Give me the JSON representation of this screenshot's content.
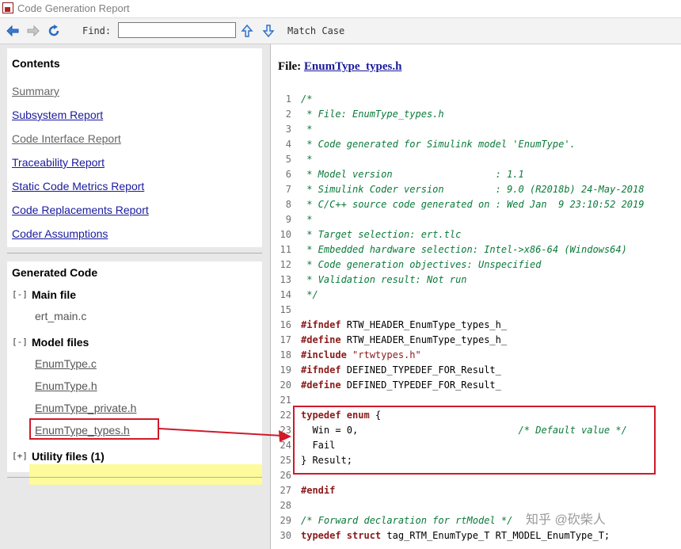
{
  "window": {
    "title": "Code Generation Report"
  },
  "toolbar": {
    "back_icon": "back-arrow-icon",
    "forward_icon": "forward-arrow-icon",
    "refresh_icon": "refresh-icon",
    "find_label": "Find:",
    "find_value": "",
    "find_up_icon": "find-up-icon",
    "find_down_icon": "find-down-icon",
    "match_case_label": "Match Case"
  },
  "contents": {
    "title": "Contents",
    "links": [
      {
        "label": "Summary",
        "style": "gray"
      },
      {
        "label": "Subsystem Report",
        "style": "blue"
      },
      {
        "label": "Code Interface Report",
        "style": "gray"
      },
      {
        "label": "Traceability Report",
        "style": "blue"
      },
      {
        "label": "Static Code Metrics Report",
        "style": "blue"
      },
      {
        "label": "Code Replacements Report",
        "style": "blue"
      },
      {
        "label": "Coder Assumptions",
        "style": "blue"
      }
    ]
  },
  "generated_code": {
    "title": "Generated Code",
    "main_file": {
      "toggle": "[-]",
      "label": "Main file",
      "files": [
        "ert_main.c"
      ]
    },
    "model_files": {
      "toggle": "[-]",
      "label": "Model files",
      "files": [
        "EnumType.c",
        "EnumType.h",
        "EnumType_private.h",
        "EnumType_types.h"
      ]
    },
    "utility_files": {
      "toggle": "[+]",
      "label": "Utility files (1)"
    }
  },
  "file_view": {
    "prefix": "File:",
    "filename": "EnumType_types.h",
    "lines": [
      {
        "n": "1",
        "text": "/*",
        "type": "comment"
      },
      {
        "n": "2",
        "text": " * File: EnumType_types.h",
        "type": "comment"
      },
      {
        "n": "3",
        "text": " *",
        "type": "comment"
      },
      {
        "n": "4",
        "text": " * Code generated for Simulink model 'EnumType'.",
        "type": "comment"
      },
      {
        "n": "5",
        "text": " *",
        "type": "comment"
      },
      {
        "n": "6",
        "text": " * Model version                  : 1.1",
        "type": "comment"
      },
      {
        "n": "7",
        "text": " * Simulink Coder version         : 9.0 (R2018b) 24-May-2018",
        "type": "comment"
      },
      {
        "n": "8",
        "text": " * C/C++ source code generated on : Wed Jan  9 23:10:52 2019",
        "type": "comment"
      },
      {
        "n": "9",
        "text": " *",
        "type": "comment"
      },
      {
        "n": "10",
        "text": " * Target selection: ert.tlc",
        "type": "comment"
      },
      {
        "n": "11",
        "text": " * Embedded hardware selection: Intel->x86-64 (Windows64)",
        "type": "comment"
      },
      {
        "n": "12",
        "text": " * Code generation objectives: Unspecified",
        "type": "comment"
      },
      {
        "n": "13",
        "text": " * Validation result: Not run",
        "type": "comment"
      },
      {
        "n": "14",
        "text": " */",
        "type": "comment"
      },
      {
        "n": "15",
        "text": "",
        "type": "plain"
      },
      {
        "n": "16",
        "kw": "#ifndef",
        "rest": " RTW_HEADER_EnumType_types_h_",
        "type": "kw"
      },
      {
        "n": "17",
        "kw": "#define",
        "rest": " RTW_HEADER_EnumType_types_h_",
        "type": "kw"
      },
      {
        "n": "18",
        "kw": "#include",
        "str": " \"rtwtypes.h\"",
        "type": "kwstr"
      },
      {
        "n": "19",
        "kw": "#ifndef",
        "rest": " DEFINED_TYPEDEF_FOR_Result_",
        "type": "kw"
      },
      {
        "n": "20",
        "kw": "#define",
        "rest": " DEFINED_TYPEDEF_FOR_Result_",
        "type": "kw"
      },
      {
        "n": "21",
        "text": "",
        "type": "plain"
      },
      {
        "n": "22",
        "kw": "typedef enum",
        "rest": " {",
        "type": "kw"
      },
      {
        "n": "23",
        "text": "  Win = 0,                            ",
        "comment": "/* Default value */",
        "type": "codecomment"
      },
      {
        "n": "24",
        "text": "  Fail",
        "type": "plain"
      },
      {
        "n": "25",
        "text": "} Result;",
        "type": "plain"
      },
      {
        "n": "26",
        "text": "",
        "type": "plain"
      },
      {
        "n": "27",
        "kw": "#endif",
        "rest": "",
        "type": "kw"
      },
      {
        "n": "28",
        "text": "",
        "type": "plain"
      },
      {
        "n": "29",
        "text": "/* Forward declaration for rtModel */",
        "type": "comment"
      },
      {
        "n": "30",
        "kw": "typedef struct",
        "rest": " tag_RTM_EnumType_T RT_MODEL_EnumType_T;",
        "type": "kw"
      }
    ]
  },
  "watermark": "知乎 @砍柴人",
  "colors": {
    "link": "#1a1a9c",
    "highlight": "#fdfb9b",
    "annotation_red": "#d11a2a",
    "comment": "#0a7a3a",
    "keyword": "#8b1a1a"
  }
}
